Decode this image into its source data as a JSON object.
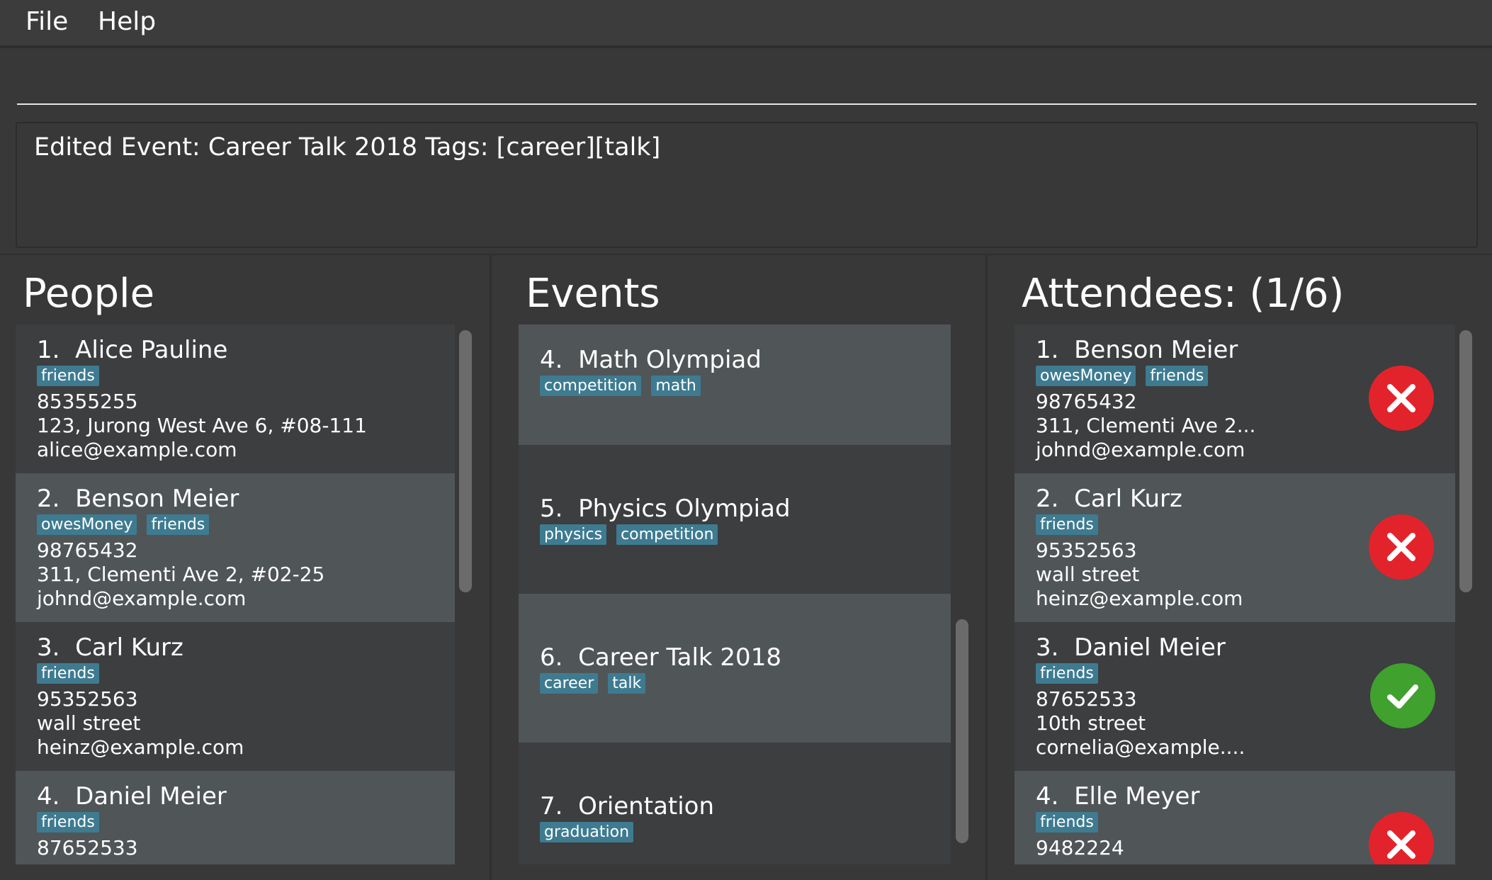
{
  "menu": {
    "file": "File",
    "help": "Help"
  },
  "command": {
    "value": ""
  },
  "result": {
    "text": "Edited Event: Career Talk 2018 Tags: [career][talk]"
  },
  "people": {
    "title": "People",
    "items": [
      {
        "index": "1.",
        "name": "Alice Pauline",
        "tags": [
          "friends"
        ],
        "phone": "85355255",
        "address": "123, Jurong West Ave 6, #08-111",
        "email": "alice@example.com"
      },
      {
        "index": "2.",
        "name": "Benson Meier",
        "tags": [
          "owesMoney",
          "friends"
        ],
        "phone": "98765432",
        "address": "311, Clementi Ave 2, #02-25",
        "email": "johnd@example.com"
      },
      {
        "index": "3.",
        "name": "Carl Kurz",
        "tags": [
          "friends"
        ],
        "phone": "95352563",
        "address": "wall street",
        "email": "heinz@example.com"
      },
      {
        "index": "4.",
        "name": "Daniel Meier",
        "tags": [
          "friends"
        ],
        "phone": "87652533",
        "address": "",
        "email": ""
      }
    ]
  },
  "events": {
    "title": "Events",
    "items": [
      {
        "index": "4.",
        "name": "Math Olympiad",
        "tags": [
          "competition",
          "math"
        ]
      },
      {
        "index": "5.",
        "name": "Physics Olympiad",
        "tags": [
          "physics",
          "competition"
        ]
      },
      {
        "index": "6.",
        "name": "Career Talk 2018",
        "tags": [
          "career",
          "talk"
        ]
      },
      {
        "index": "7.",
        "name": "Orientation",
        "tags": [
          "graduation"
        ]
      }
    ]
  },
  "attendees": {
    "title": "Attendees: (1/6)",
    "items": [
      {
        "index": "1.",
        "name": "Benson Meier",
        "tags": [
          "owesMoney",
          "friends"
        ],
        "phone": "98765432",
        "address": "311, Clementi Ave 2...",
        "email": "johnd@example.com",
        "status": "absent"
      },
      {
        "index": "2.",
        "name": "Carl Kurz",
        "tags": [
          "friends"
        ],
        "phone": "95352563",
        "address": "wall street",
        "email": "heinz@example.com",
        "status": "absent"
      },
      {
        "index": "3.",
        "name": "Daniel Meier",
        "tags": [
          "friends"
        ],
        "phone": "87652533",
        "address": "10th street",
        "email": "cornelia@example....",
        "status": "present"
      },
      {
        "index": "4.",
        "name": "Elle Meyer",
        "tags": [
          "friends"
        ],
        "phone": "9482224",
        "address": "",
        "email": "",
        "status": "absent"
      }
    ]
  },
  "colors": {
    "tag": "#3e7b91",
    "absent": "#e3232b",
    "present": "#40a12e",
    "card_dark": "#3c3e3f",
    "card_light": "#505557"
  }
}
